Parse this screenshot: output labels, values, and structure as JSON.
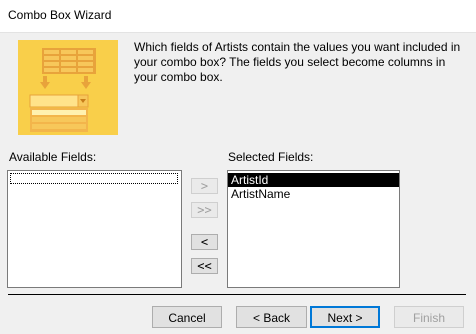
{
  "window": {
    "title": "Combo Box Wizard"
  },
  "instruction": "Which fields of Artists contain the values you want included in your combo box? The fields you select become columns in your combo box.",
  "available_fields": {
    "label": "Available Fields:",
    "items": []
  },
  "selected_fields": {
    "label": "Selected Fields:",
    "items": [
      "ArtistId",
      "ArtistName"
    ],
    "selected_index": 0
  },
  "move_buttons": {
    "add_one": ">",
    "add_all": ">>",
    "remove_one": "<",
    "remove_all": "<<"
  },
  "footer": {
    "cancel": "Cancel",
    "back": "< Back",
    "next": "Next >",
    "finish": "Finish"
  },
  "colors": {
    "illustration": "#f9cf4a",
    "illustration_dark": "#e8a33b",
    "selection": "#000000"
  }
}
